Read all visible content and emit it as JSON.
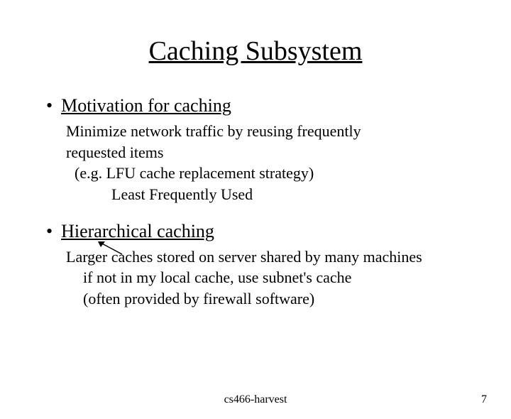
{
  "title": "Caching Subsystem",
  "bullets": [
    {
      "heading": "Motivation for caching",
      "lines": [
        {
          "text": "Minimize network traffic by reusing frequently",
          "cls": ""
        },
        {
          "text": "requested items",
          "cls": ""
        },
        {
          "text": "(e.g. LFU cache replacement strategy)",
          "cls": "indent1"
        },
        {
          "text": "Least Frequently Used",
          "cls": "indent2"
        }
      ]
    },
    {
      "heading": "Hierarchical caching",
      "lines": [
        {
          "text": "Larger caches stored on server shared by many machines",
          "cls": ""
        },
        {
          "text": "if not in my local cache, use subnet's cache",
          "cls": "indent3"
        },
        {
          "text": "(often provided by firewall software)",
          "cls": "indent3"
        }
      ]
    }
  ],
  "footer": {
    "center": "cs466-harvest",
    "right": "7"
  }
}
